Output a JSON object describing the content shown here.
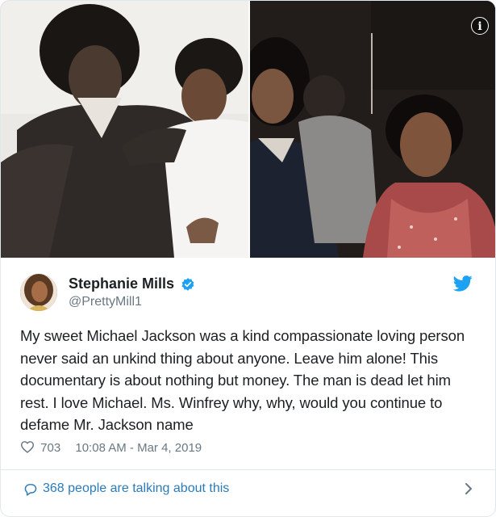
{
  "tweet": {
    "display_name": "Stephanie Mills",
    "handle": "@PrettyMill1",
    "verified": true,
    "text": "My sweet Michael Jackson was a kind compassionate loving person never said an unkind thing about anyone. Leave him alone! This documentary is about nothing but money. The man is dead let him rest. I love Michael. Ms. Winfrey why, why, would you continue to defame Mr. Jackson name",
    "likes": "703",
    "timestamp": "10:08 AM - Mar 4, 2019",
    "conversation_label": "368 people are talking about this"
  },
  "media": {
    "info_glyph": "i",
    "photos": [
      "photo-left",
      "photo-right"
    ]
  },
  "icons": {
    "verified": "verified-badge-icon",
    "brand": "twitter-bird-icon",
    "like": "heart-icon",
    "reply": "comment-bubble-icon",
    "more": "chevron-right-icon"
  },
  "colors": {
    "accent": "#1da1f2",
    "link": "#2b7bb9",
    "muted": "#697882",
    "text": "#1c2022",
    "border": "#e1e8ed"
  }
}
